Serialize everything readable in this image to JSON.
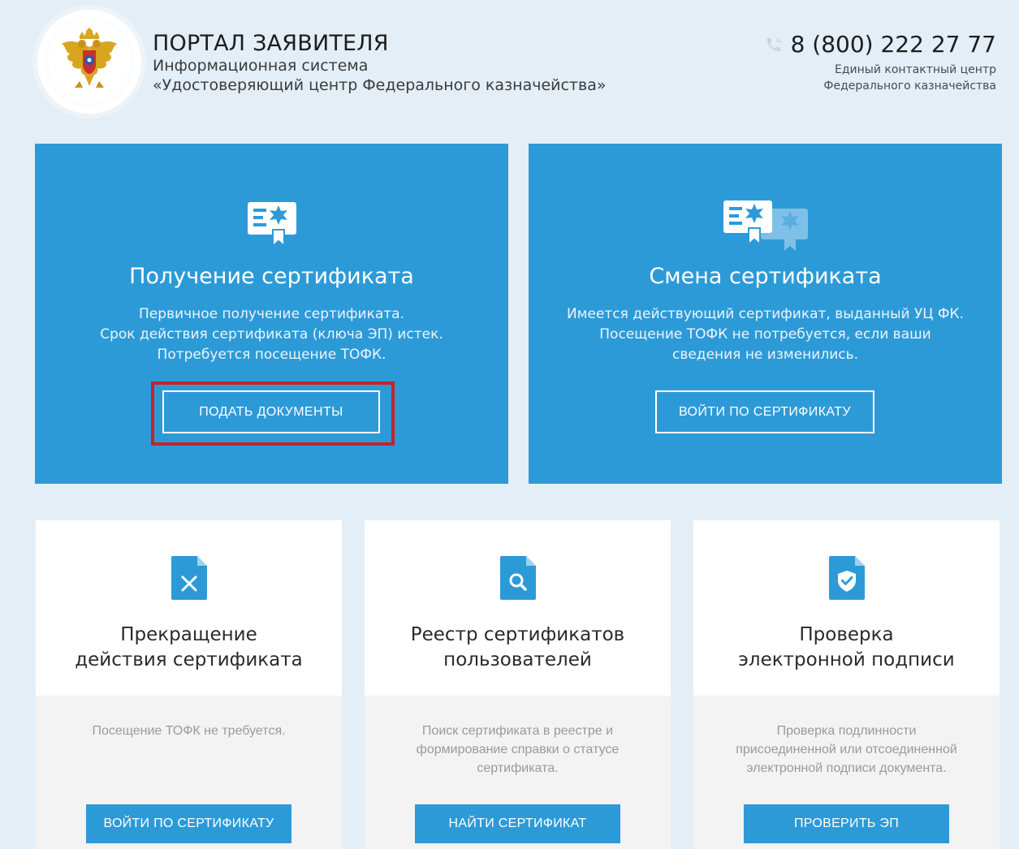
{
  "header": {
    "title": "ПОРТАЛ ЗАЯВИТЕЛЯ",
    "subtitle_line1": "Информационная система",
    "subtitle_line2": "«Удостоверяющий центр Федерального казначейства»",
    "phone": "8 (800) 222 27 77",
    "contact_line1": "Единый контактный центр",
    "contact_line2": "Федерального казначейства",
    "logo_icon": "double-headed-eagle-emblem-icon",
    "phone_icon": "phone-handset-icon"
  },
  "colors": {
    "page_bg": "#e4eef6",
    "primary_blue": "#2d9ad8",
    "highlight_red": "#c5232d",
    "card_white": "#ffffff",
    "card_gray": "#f3f3f3"
  },
  "main_cards": [
    {
      "icon": "certificate-ribbon-icon",
      "title": "Получение сертификата",
      "desc_line1": "Первичное получение сертификата.",
      "desc_line2": "Срок действия сертификата (ключа ЭП) истек.",
      "desc_line3": "Потребуется посещение ТОФК.",
      "button": "ПОДАТЬ ДОКУМЕНТЫ"
    },
    {
      "icon": "certificate-exchange-icon",
      "title": "Смена сертификата",
      "desc_line1": "Имеется действующий сертификат, выданный УЦ ФК.",
      "desc_line2": "Посещение ТОФК не потребуется, если ваши",
      "desc_line3": "сведения не изменились.",
      "button": "ВОЙТИ ПО СЕРТИФИКАТУ"
    }
  ],
  "service_cards": [
    {
      "icon": "document-cross-icon",
      "title_line1": "Прекращение",
      "title_line2": "действия сертификата",
      "desc_line1": "Посещение ТОФК не требуется.",
      "desc_line2": "",
      "desc_line3": "",
      "button": "ВОЙТИ ПО СЕРТИФИКАТУ"
    },
    {
      "icon": "document-search-icon",
      "title_line1": "Реестр сертификатов",
      "title_line2": "пользователей",
      "desc_line1": "Поиск сертификата в реестре и",
      "desc_line2": "формирование справки о статусе",
      "desc_line3": "сертификата.",
      "button": "НАЙТИ СЕРТИФИКАТ"
    },
    {
      "icon": "document-shield-check-icon",
      "title_line1": "Проверка",
      "title_line2": "электронной подписи",
      "desc_line1": "Проверка подлинности",
      "desc_line2": "присоединенной или отсоединенной",
      "desc_line3": "электронной подписи документа.",
      "button": "ПРОВЕРИТЬ ЭП"
    }
  ]
}
